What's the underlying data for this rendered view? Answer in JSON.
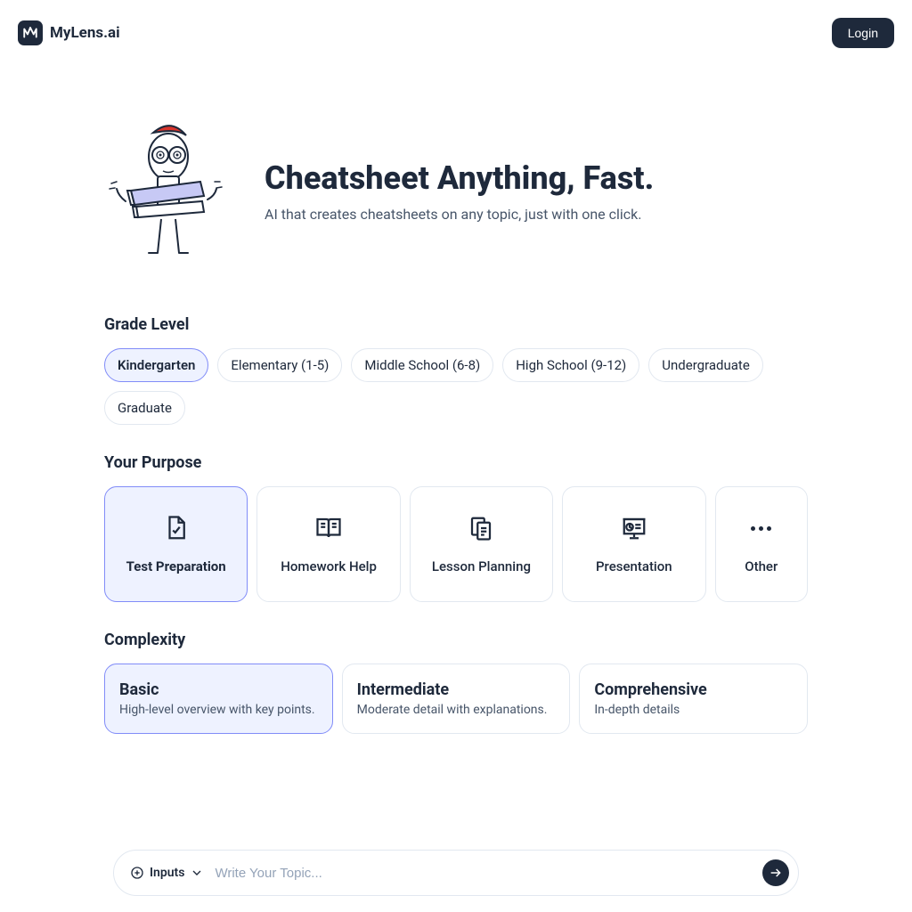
{
  "brand": {
    "name": "MyLens.ai"
  },
  "header": {
    "login_label": "Login"
  },
  "hero": {
    "title": "Cheatsheet Anything, Fast.",
    "subtitle": "AI that creates cheatsheets on any topic, just with one click."
  },
  "grade": {
    "label": "Grade Level",
    "options": [
      {
        "label": "Kindergarten",
        "selected": true
      },
      {
        "label": "Elementary (1-5)",
        "selected": false
      },
      {
        "label": "Middle School (6-8)",
        "selected": false
      },
      {
        "label": "High School (9-12)",
        "selected": false
      },
      {
        "label": "Undergraduate",
        "selected": false
      },
      {
        "label": "Graduate",
        "selected": false
      }
    ]
  },
  "purpose": {
    "label": "Your Purpose",
    "options": [
      {
        "label": "Test Preparation",
        "icon": "document-check-icon",
        "selected": true
      },
      {
        "label": "Homework Help",
        "icon": "book-open-icon",
        "selected": false
      },
      {
        "label": "Lesson Planning",
        "icon": "clipboard-document-icon",
        "selected": false
      },
      {
        "label": "Presentation",
        "icon": "presentation-screen-icon",
        "selected": false
      },
      {
        "label": "Other",
        "icon": "dots-icon",
        "selected": false
      }
    ]
  },
  "complexity": {
    "label": "Complexity",
    "options": [
      {
        "title": "Basic",
        "desc": "High-level overview with key points.",
        "selected": true
      },
      {
        "title": "Intermediate",
        "desc": "Moderate detail with explanations.",
        "selected": false
      },
      {
        "title": "Comprehensive",
        "desc": "In-depth details",
        "selected": false
      }
    ]
  },
  "bottom": {
    "inputs_label": "Inputs",
    "placeholder": "Write Your Topic..."
  },
  "colors": {
    "primary_dark": "#1e293b",
    "selected_bg": "#eef2ff",
    "selected_border": "#818cf8",
    "border": "#e2e8f0",
    "accent_red": "#d9352c",
    "accent_lavender": "#c7c9f5"
  }
}
